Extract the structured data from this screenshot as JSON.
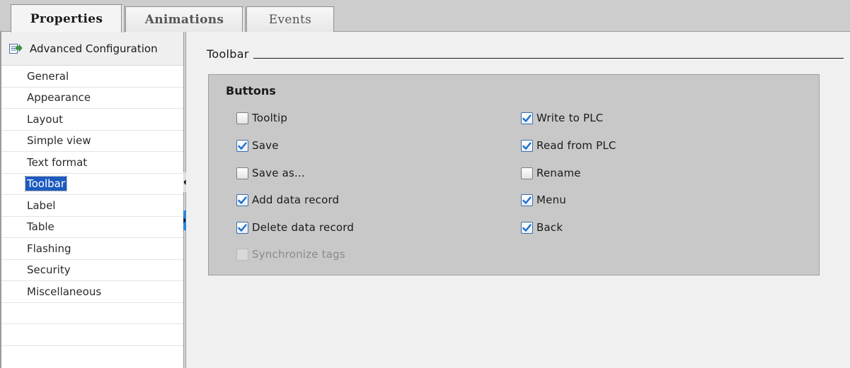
{
  "colors": {
    "selection": "#1c5bc0",
    "checkbox_check": "#1c6fd0",
    "group_background": "#c8c8c8",
    "splitter_accent": "#2f86d6"
  },
  "tabs": [
    {
      "label": "Properties",
      "active": true
    },
    {
      "label": "Animations",
      "active": false
    },
    {
      "label": "Events",
      "active": false
    }
  ],
  "sidebar": {
    "advanced": {
      "label": "Advanced Configuration",
      "icon": "advanced-config-icon"
    },
    "items": [
      {
        "label": "General"
      },
      {
        "label": "Appearance"
      },
      {
        "label": "Layout"
      },
      {
        "label": "Simple view"
      },
      {
        "label": "Text format"
      },
      {
        "label": "Toolbar",
        "selected": true
      },
      {
        "label": "Label"
      },
      {
        "label": "Table"
      },
      {
        "label": "Flashing"
      },
      {
        "label": "Security"
      },
      {
        "label": "Miscellaneous"
      }
    ]
  },
  "section": {
    "title": "Toolbar"
  },
  "buttons_group": {
    "title": "Buttons",
    "left_column": [
      {
        "label": "Tooltip",
        "checked": false,
        "enabled": true
      },
      {
        "label": "Save",
        "checked": true,
        "enabled": true
      },
      {
        "label": "Save as...",
        "checked": false,
        "enabled": true
      },
      {
        "label": "Add data record",
        "checked": true,
        "enabled": true
      },
      {
        "label": "Delete data record",
        "checked": true,
        "enabled": true
      },
      {
        "label": "Synchronize tags",
        "checked": false,
        "enabled": false
      }
    ],
    "right_column": [
      {
        "label": "Write to PLC",
        "checked": true,
        "enabled": true
      },
      {
        "label": "Read from PLC",
        "checked": true,
        "enabled": true
      },
      {
        "label": "Rename",
        "checked": false,
        "enabled": true
      },
      {
        "label": "Menu",
        "checked": true,
        "enabled": true
      },
      {
        "label": "Back",
        "checked": true,
        "enabled": true
      }
    ]
  }
}
